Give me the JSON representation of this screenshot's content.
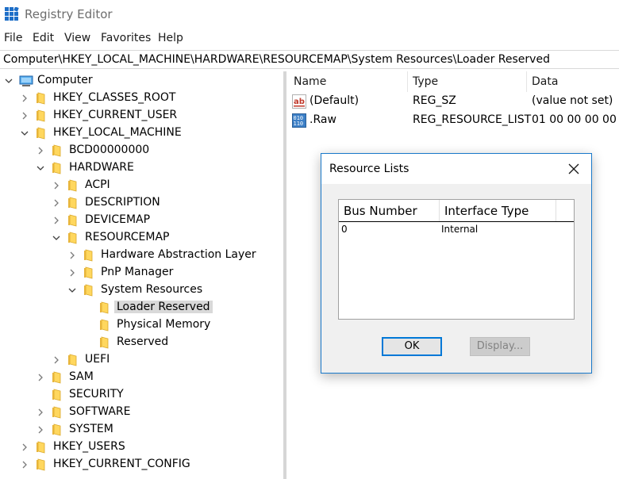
{
  "window": {
    "title": "Registry Editor"
  },
  "menu": [
    "File",
    "Edit",
    "View",
    "Favorites",
    "Help"
  ],
  "address": "Computer\\HKEY_LOCAL_MACHINE\\HARDWARE\\RESOURCEMAP\\System Resources\\Loader Reserved",
  "tree": [
    {
      "label": "Computer",
      "level": 0,
      "state": "expanded",
      "icon": "computer-icon"
    },
    {
      "label": "HKEY_CLASSES_ROOT",
      "level": 1,
      "state": "collapsed",
      "icon": "folder-icon"
    },
    {
      "label": "HKEY_CURRENT_USER",
      "level": 1,
      "state": "collapsed",
      "icon": "folder-icon"
    },
    {
      "label": "HKEY_LOCAL_MACHINE",
      "level": 1,
      "state": "expanded",
      "icon": "folder-icon"
    },
    {
      "label": "BCD00000000",
      "level": 2,
      "state": "collapsed",
      "icon": "folder-icon"
    },
    {
      "label": "HARDWARE",
      "level": 2,
      "state": "expanded",
      "icon": "folder-icon"
    },
    {
      "label": "ACPI",
      "level": 3,
      "state": "collapsed",
      "icon": "folder-icon"
    },
    {
      "label": "DESCRIPTION",
      "level": 3,
      "state": "collapsed",
      "icon": "folder-icon"
    },
    {
      "label": "DEVICEMAP",
      "level": 3,
      "state": "collapsed",
      "icon": "folder-icon"
    },
    {
      "label": "RESOURCEMAP",
      "level": 3,
      "state": "expanded",
      "icon": "folder-icon"
    },
    {
      "label": "Hardware Abstraction Layer",
      "level": 4,
      "state": "collapsed",
      "icon": "folder-icon"
    },
    {
      "label": "PnP Manager",
      "level": 4,
      "state": "collapsed",
      "icon": "folder-icon"
    },
    {
      "label": "System Resources",
      "level": 4,
      "state": "expanded",
      "icon": "folder-icon"
    },
    {
      "label": "Loader Reserved",
      "level": 5,
      "state": "leaf",
      "icon": "folder-icon",
      "selected": true
    },
    {
      "label": "Physical Memory",
      "level": 5,
      "state": "leaf",
      "icon": "folder-icon"
    },
    {
      "label": "Reserved",
      "level": 5,
      "state": "leaf",
      "icon": "folder-icon"
    },
    {
      "label": "UEFI",
      "level": 3,
      "state": "collapsed",
      "icon": "folder-icon"
    },
    {
      "label": "SAM",
      "level": 2,
      "state": "collapsed",
      "icon": "folder-icon"
    },
    {
      "label": "SECURITY",
      "level": 2,
      "state": "leaf",
      "icon": "folder-icon"
    },
    {
      "label": "SOFTWARE",
      "level": 2,
      "state": "collapsed",
      "icon": "folder-icon"
    },
    {
      "label": "SYSTEM",
      "level": 2,
      "state": "collapsed",
      "icon": "folder-icon"
    },
    {
      "label": "HKEY_USERS",
      "level": 1,
      "state": "collapsed",
      "icon": "folder-icon"
    },
    {
      "label": "HKEY_CURRENT_CONFIG",
      "level": 1,
      "state": "collapsed",
      "icon": "folder-icon"
    }
  ],
  "values_header": {
    "name": "Name",
    "type": "Type",
    "data": "Data"
  },
  "values": [
    {
      "name": "(Default)",
      "type": "REG_SZ",
      "data": "(value not set)",
      "icon": "string-value-icon"
    },
    {
      "name": ".Raw",
      "type": "REG_RESOURCE_LIST",
      "data": "01 00 00 00 00 00",
      "icon": "binary-value-icon"
    }
  ],
  "dialog": {
    "title": "Resource Lists",
    "columns": [
      "Bus Number",
      "Interface Type"
    ],
    "rows": [
      [
        "0",
        "Internal"
      ]
    ],
    "ok_label": "OK",
    "display_label": "Display...",
    "display_enabled": false
  },
  "colors": {
    "folder": "#ffd75e",
    "selection": "#d9d9d9",
    "dialog_border": "#1979ca",
    "ok_focus": "#0078d7",
    "app_icon": "#1e6fc8"
  }
}
